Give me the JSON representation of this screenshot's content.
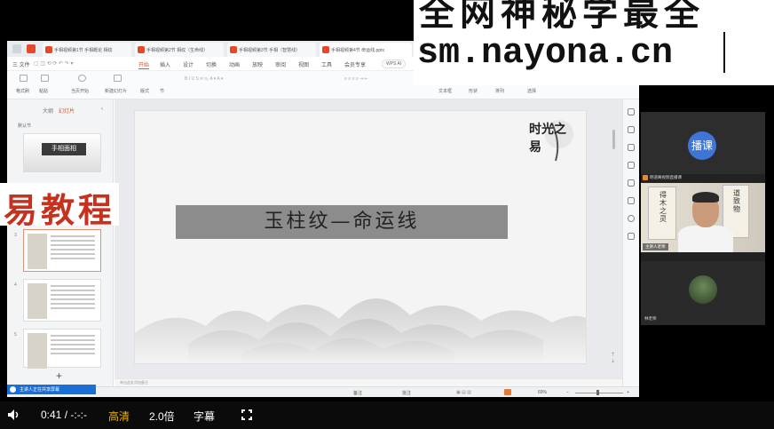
{
  "watermark": {
    "line1": "全网神秘学最全",
    "line2": "sm.nayona.cn"
  },
  "wps": {
    "tabs": [
      {
        "label": "手相视频第1节 手相概论 相纹"
      },
      {
        "label": "手相视频第2节 相纹（生命线）"
      },
      {
        "label": "手相视频第3节 手相（智慧线）"
      },
      {
        "label": "手相视频第4节 命运线.pptx"
      }
    ],
    "menu": [
      "三 文件",
      "开始",
      "插入",
      "设计",
      "切换",
      "动画",
      "放映",
      "审阅",
      "视图",
      "工具",
      "会员专享"
    ],
    "active_menu": "开始",
    "wps_ai": "WPS AI",
    "ribbon": {
      "format_painter": "格式刷",
      "paste": "粘贴",
      "start_from_current": "当页开始",
      "new_slide": "新建幻灯片",
      "layout": "版式",
      "section": "节",
      "textbox": "文本框",
      "shape": "形状",
      "arrange": "排列",
      "find": "选择"
    },
    "pane": {
      "tab_outline": "大纲",
      "tab_slides": "幻灯片",
      "section_label": "默认节",
      "thumb_title": "手相面相",
      "slide_numbers": [
        "3",
        "4",
        "5"
      ]
    },
    "slide": {
      "title": "玉柱纹—命运线",
      "deco_text": "时光之易"
    },
    "note_placeholder": "单击此处添加备注",
    "status": {
      "notes": "备注",
      "comment": "批注",
      "zoom": "69%"
    }
  },
  "streamer_label": "主讲人正在共享屏幕",
  "participants": {
    "host_badge": "播课",
    "host_name": "明道阁视频直播课",
    "teacher_name": "主讲人老师",
    "scroll_left": "得木之灵",
    "scroll_right": "道 致 物",
    "bottom_name": "林老师"
  },
  "overlay_subtitle": "易教程",
  "player": {
    "time": "0:41 / -:-:-",
    "quality": "高清",
    "speed": "2.0倍",
    "subtitle": "字幕"
  }
}
